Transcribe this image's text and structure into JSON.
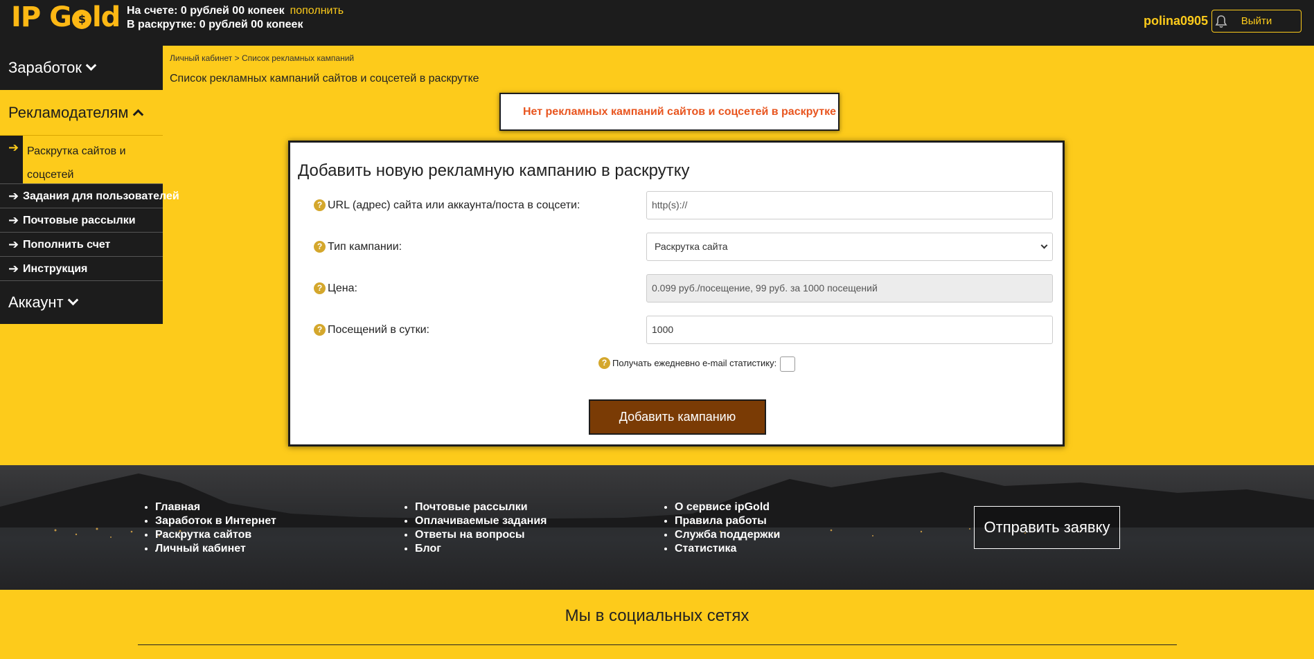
{
  "header": {
    "logo": {
      "left": "IP G",
      "coin": "$",
      "right": "ld"
    },
    "balance_line": "На счете: 0 рублей 00 копеек",
    "topup_link": "пополнить",
    "promo_line": "В раскрутке: 0 рублей 00 копеек",
    "username": "polina0905",
    "logout_label": "Выйти"
  },
  "sidebar": {
    "earnings": "Заработок",
    "advertisers": "Рекламодателям",
    "items": [
      {
        "label": "Раскрутка сайтов и соцсетей",
        "current": true
      },
      {
        "label": "Задания для пользователей"
      },
      {
        "label": "Почтовые рассылки"
      },
      {
        "label": "Пополнить счет"
      },
      {
        "label": "Инструкция"
      }
    ],
    "account": "Аккаунт"
  },
  "breadcrumb": {
    "home": "Личный кабинет",
    "sep": ">",
    "current": "Список рекламных кампаний"
  },
  "page_title": "Список рекламных кампаний сайтов и соцсетей в раскрутке",
  "notice": "Нет рекламных кампаний сайтов и соцсетей в раскрутке",
  "form": {
    "title": "Добавить новую рекламную кампанию в раскрутку",
    "url_label": "URL (адрес) сайта или аккаунта/поста в соцсети:",
    "url_placeholder": "http(s)://",
    "type_label": "Тип кампании:",
    "type_value": "Раскрутка сайта",
    "price_label": "Цена:",
    "price_value": "0.099 руб./посещение, 99 руб. за 1000 посещений",
    "visits_label": "Посещений в сутки:",
    "visits_value": "1000",
    "email_label": "Получать ежедневно e-mail статистику:",
    "submit_label": "Добавить кампанию"
  },
  "footer": {
    "col1": [
      "Главная",
      "Заработок в Интернет",
      "Раскрутка сайтов",
      "Личный кабинет"
    ],
    "col2": [
      "Почтовые рассылки",
      "Оплачиваемые задания",
      "Ответы на вопросы",
      "Блог"
    ],
    "col3": [
      "О сервисе ipGold",
      "Правила работы",
      "Служба поддержки",
      "Статистика"
    ],
    "request_label": "Отправить заявку"
  },
  "social_title": "Мы в социальных сетях",
  "colors": {
    "accent": "#fdcb1b",
    "dark": "#1c1c1c",
    "button": "#7a3b05",
    "notice": "#e8551f"
  }
}
